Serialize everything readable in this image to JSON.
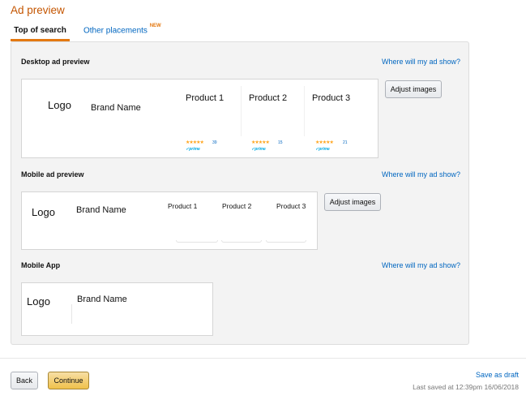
{
  "page_title": "Ad preview",
  "tabs": [
    {
      "label": "Top of search",
      "active": true
    },
    {
      "label": "Other placements",
      "badge": "NEW",
      "active": false
    }
  ],
  "desktop": {
    "title": "Desktop ad preview",
    "where_link": "Where will my ad show?",
    "adjust_label": "Adjust images",
    "logo": "Logo",
    "brand": "Brand Name",
    "products": [
      {
        "name": "Product 1",
        "stars": "★★★★★",
        "count": "39",
        "prime": "✓prime"
      },
      {
        "name": "Product 2",
        "stars": "★★★★★",
        "count": "15",
        "prime": "✓prime"
      },
      {
        "name": "Product 3",
        "stars": "★★★★★",
        "count": "21",
        "prime": "✓prime"
      }
    ]
  },
  "mobile": {
    "title": "Mobile ad preview",
    "where_link": "Where will my ad show?",
    "adjust_label": "Adjust images",
    "logo": "Logo",
    "brand": "Brand Name",
    "products": [
      "Product 1",
      "Product 2",
      "Product 3"
    ]
  },
  "app": {
    "title": "Mobile App",
    "where_link": "Where will my ad show?",
    "logo": "Logo",
    "brand": "Brand Name"
  },
  "footer": {
    "back_label": "Back",
    "continue_label": "Continue",
    "save_draft_label": "Save as draft",
    "last_saved": "Last saved at 12:39pm 16/06/2018"
  },
  "colors": {
    "title_orange": "#c45500",
    "tab_underline": "#e47911",
    "link_blue": "#0066c0",
    "star_gold": "#ffa41c",
    "continue_yellow": "#f0c14b"
  }
}
